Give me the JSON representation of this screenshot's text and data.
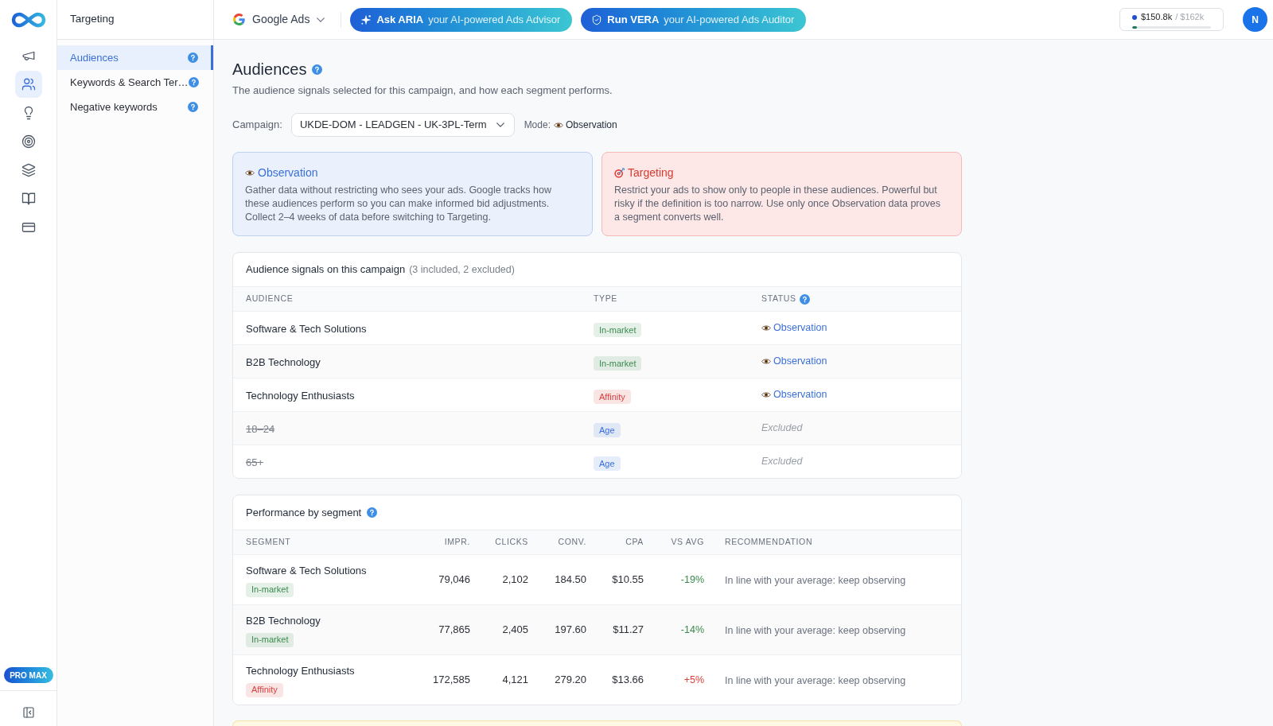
{
  "rail": {
    "items": [
      {
        "selected": false
      },
      {
        "selected": true
      },
      {
        "selected": false
      },
      {
        "selected": false
      },
      {
        "selected": false
      },
      {
        "selected": false
      },
      {
        "selected": false
      }
    ],
    "plan_badge": "PRO MAX"
  },
  "nav": {
    "title": "Targeting",
    "items": [
      {
        "label": "Audiences",
        "selected": true
      },
      {
        "label": "Keywords & Search Ter…",
        "selected": false
      },
      {
        "label": "Negative keywords",
        "selected": false
      }
    ]
  },
  "top_bar": {
    "platform": "Google Ads",
    "buttons": [
      {
        "label": "Ask ARIA",
        "caption": "your AI-powered Ads Advisor"
      },
      {
        "label": "Run VERA",
        "caption": "your AI-powered Ads Auditor"
      }
    ],
    "budget": {
      "spent": "$150.8k",
      "limit": "/ $162k",
      "level": 0.06
    },
    "avatar": "N"
  },
  "page": {
    "title": "Audiences",
    "subtitle": "The audience signals selected for this campaign, and how each segment performs.",
    "campaign_label": "Campaign:",
    "campaign": "UKDE-DOM - LEADGEN - UK-3PL-Term",
    "mode_label": "Mode:",
    "mode": "Observation"
  },
  "mode_cards": [
    {
      "kind": "observation",
      "title": "Observation",
      "text": "Gather data without restricting who sees your ads. Google tracks how these audiences perform so you can make informed bid adjustments. Collect 2–4 weeks of data before switching to Targeting."
    },
    {
      "kind": "targeting",
      "title": "Targeting",
      "text": "Restrict your ads to show only to people in these audiences. Powerful but risky if the definition is too narrow. Use only once Observation data proves a segment converts well."
    }
  ],
  "signals": {
    "title": "Audience signals on this campaign",
    "summary": "(3 included, 2 excluded)",
    "columns": [
      {
        "label": "AUDIENCE",
        "help": false
      },
      {
        "label": "TYPE",
        "help": false
      },
      {
        "label": "STATUS",
        "help": true
      }
    ],
    "rows": [
      {
        "audience": "Software & Tech Solutions",
        "type": {
          "label": "In-market",
          "color": "#3d8b4f"
        },
        "status": "Observation",
        "excluded": false
      },
      {
        "audience": "B2B Technology",
        "type": {
          "label": "In-market",
          "color": "#3d8b4f"
        },
        "status": "Observation",
        "excluded": false
      },
      {
        "audience": "Technology Enthusiasts",
        "type": {
          "label": "Affinity",
          "color": "#d93f3f"
        },
        "status": "Observation",
        "excluded": false
      },
      {
        "audience": "18–24",
        "type": {
          "label": "Age",
          "color": "#3a6fd8"
        },
        "status": "Excluded",
        "excluded": true
      },
      {
        "audience": "65+",
        "type": {
          "label": "Age",
          "color": "#3a6fd8"
        },
        "status": "Excluded",
        "excluded": true
      }
    ]
  },
  "performance": {
    "title": "Performance by segment",
    "columns": [
      "SEGMENT",
      "IMPR.",
      "CLICKS",
      "CONV.",
      "CPA",
      "VS AVG",
      "RECOMMENDATION"
    ],
    "rows": [
      {
        "segment": "Software & Tech Solutions",
        "type": {
          "label": "In-market",
          "color": "#3d8b4f"
        },
        "impr": "79,046",
        "clicks": "2,102",
        "conv": "184.50",
        "cpa": "$10.55",
        "vs_avg": {
          "text": "-19%",
          "color": "#3a8a4c"
        },
        "recommendation": "In line with your average: keep observing"
      },
      {
        "segment": "B2B Technology",
        "type": {
          "label": "In-market",
          "color": "#3d8b4f"
        },
        "impr": "77,865",
        "clicks": "2,405",
        "conv": "197.60",
        "cpa": "$11.27",
        "vs_avg": {
          "text": "-14%",
          "color": "#3a8a4c"
        },
        "recommendation": "In line with your average: keep observing"
      },
      {
        "segment": "Technology Enthusiasts",
        "type": {
          "label": "Affinity",
          "color": "#d93f3f"
        },
        "impr": "172,585",
        "clicks": "4,121",
        "conv": "279.20",
        "cpa": "$13.66",
        "vs_avg": {
          "text": "+5%",
          "color": "#e0403a"
        },
        "recommendation": "In line with your average: keep observing"
      }
    ]
  }
}
